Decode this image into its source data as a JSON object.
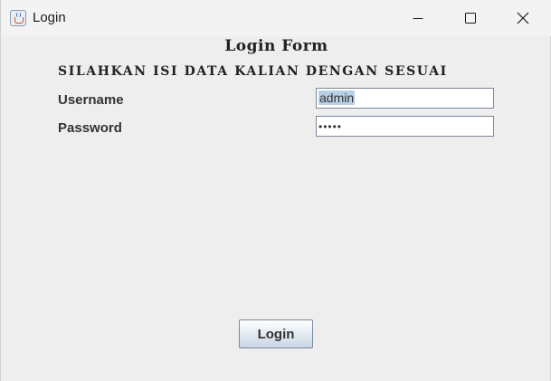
{
  "window": {
    "title": "Login",
    "icon": "java-cup-icon",
    "controls": [
      "minimize-icon",
      "maximize-icon",
      "close-icon"
    ]
  },
  "form": {
    "title": "Login Form",
    "subtitle": "SILAHKAN ISI DATA KALIAN DENGAN SESUAI",
    "username_label": "Username",
    "username_value": "admin",
    "password_label": "Password",
    "password_value": "•••••",
    "login_label": "Login"
  },
  "colors": {
    "background": "#eeeeee",
    "selection": "#b8cfe5",
    "field_border": "#7a8a9a"
  }
}
